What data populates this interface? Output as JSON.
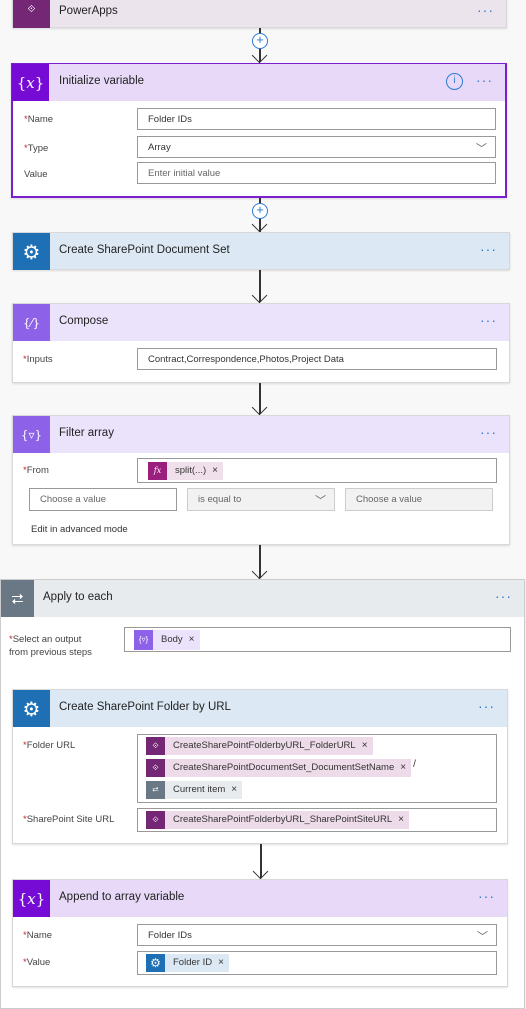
{
  "trigger": {
    "title": "PowerApps",
    "icon": "powerapps-icon"
  },
  "init_variable": {
    "title": "Initialize variable",
    "icon": "variable-icon",
    "name_label": "Name",
    "name_value": "Folder IDs",
    "type_label": "Type",
    "type_value": "Array",
    "value_label": "Value",
    "value_placeholder": "Enter initial value"
  },
  "doc_set": {
    "title": "Create SharePoint Document Set",
    "icon": "gear-icon"
  },
  "compose": {
    "title": "Compose",
    "icon": "compose-icon",
    "inputs_label": "Inputs",
    "inputs_value": "Contract,Correspondence,Photos,Project Data"
  },
  "filter": {
    "title": "Filter array",
    "icon": "filter-icon",
    "from_label": "From",
    "from_token": "split(...)",
    "left_placeholder": "Choose a value",
    "operator": "is equal to",
    "right_placeholder": "Choose a value",
    "advanced_link": "Edit in advanced mode"
  },
  "apply_each": {
    "title": "Apply to each",
    "icon": "loop-icon",
    "select_label_1": "Select an output",
    "select_label_2": "from previous steps",
    "token": "Body"
  },
  "folder": {
    "title": "Create SharePoint Folder by URL",
    "icon": "gear-icon",
    "folder_url_label": "Folder URL",
    "tokens": [
      "CreateSharePointFolderbyURL_FolderURL",
      "CreateSharePointDocumentSet_DocumentSetName",
      "Current item"
    ],
    "separator": "/",
    "site_label": "SharePoint Site URL",
    "site_token": "CreateSharePointFolderbyURL_SharePointSiteURL"
  },
  "append": {
    "title": "Append to array variable",
    "icon": "variable-icon",
    "name_label": "Name",
    "name_value": "Folder IDs",
    "value_label": "Value",
    "value_token": "Folder ID"
  },
  "colors": {
    "variable": "#770bd6",
    "sharepoint": "#1f6fb5",
    "powerapps": "#742774",
    "loop": "#6a7886",
    "compose": "#8d61e8",
    "accent": "#2c7bd1"
  }
}
